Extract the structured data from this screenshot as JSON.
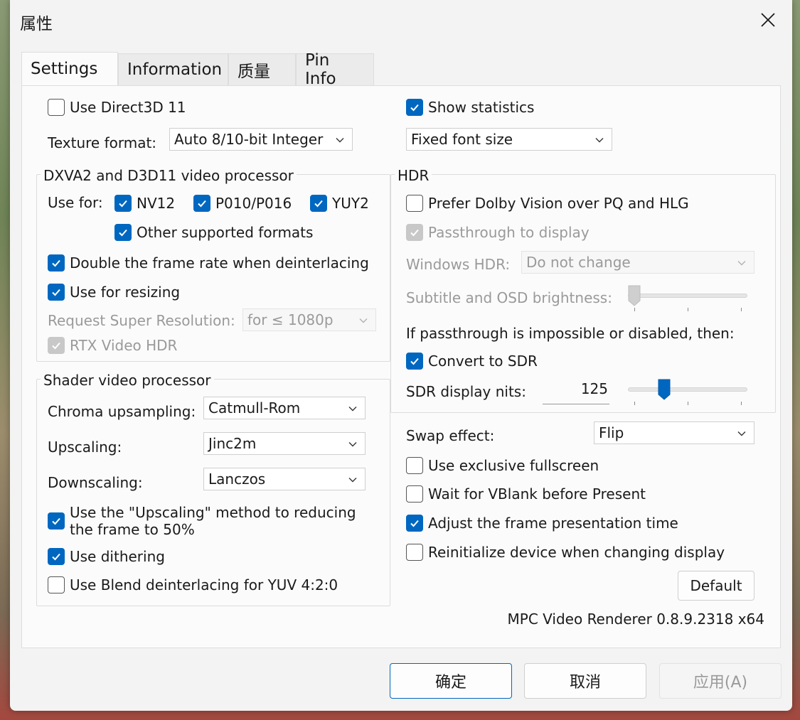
{
  "window": {
    "title": "属性"
  },
  "tabs": [
    {
      "label": "Settings"
    },
    {
      "label": "Information"
    },
    {
      "label": "质量"
    },
    {
      "label": "Pin Info"
    }
  ],
  "settings": {
    "use_d3d11": {
      "label": "Use Direct3D 11",
      "checked": false
    },
    "texture_format": {
      "label": "Texture format:",
      "value": "Auto 8/10-bit Integer"
    },
    "show_statistics": {
      "label": "Show statistics",
      "checked": true
    },
    "stats_font": {
      "value": "Fixed font size"
    },
    "dxva": {
      "title": "DXVA2 and D3D11 video processor",
      "use_for_label": "Use for:",
      "nv12": {
        "label": "NV12",
        "checked": true
      },
      "p010": {
        "label": "P010/P016",
        "checked": true
      },
      "yuy2": {
        "label": "YUY2",
        "checked": true
      },
      "other": {
        "label": "Other supported formats",
        "checked": true
      },
      "double_rate": {
        "label": "Double the frame rate when deinterlacing",
        "checked": true
      },
      "resizing": {
        "label": "Use for resizing",
        "checked": true
      },
      "super_res_label": "Request Super Resolution:",
      "super_res_value": "for ≤ 1080p",
      "rtx_hdr": {
        "label": "RTX Video HDR",
        "checked": true
      }
    },
    "shader": {
      "title": "Shader video processor",
      "chroma_label": "Chroma upsampling:",
      "chroma_value": "Catmull-Rom",
      "upscaling_label": "Upscaling:",
      "upscaling_value": "Jinc2m",
      "downscaling_label": "Downscaling:",
      "downscaling_value": "Lanczos",
      "upscale_method_line1": "Use the \"Upscaling\" method to reducing",
      "upscale_method_line2": "the frame to 50%",
      "dithering": {
        "label": "Use dithering",
        "checked": true
      },
      "blend": {
        "label": "Use Blend deinterlacing for YUV 4:2:0",
        "checked": false
      }
    },
    "hdr": {
      "title": "HDR",
      "dolby": {
        "label": "Prefer Dolby Vision over PQ and HLG",
        "checked": false
      },
      "passthrough": {
        "label": "Passthrough to display",
        "checked": true
      },
      "windows_hdr_label": "Windows HDR:",
      "windows_hdr_value": "Do not change",
      "osd_brightness_label": "Subtitle and OSD brightness:",
      "osd_brightness_level": 0,
      "fallback_label": "If passthrough is impossible or disabled, then:",
      "convert_sdr": {
        "label": "Convert to SDR",
        "checked": true
      },
      "sdr_nits_label": "SDR display nits:",
      "sdr_nits_value": "125",
      "sdr_nits_level": 0.28
    },
    "swap_effect_label": "Swap effect:",
    "swap_effect_value": "Flip",
    "exclusive_fullscreen": {
      "label": "Use exclusive fullscreen",
      "checked": false
    },
    "vblank": {
      "label": "Wait for VBlank before Present",
      "checked": false
    },
    "adjust_presentation": {
      "label": "Adjust the frame presentation time",
      "checked": true
    },
    "reinit_device": {
      "label": "Reinitialize device when changing display",
      "checked": false
    },
    "default_button": "Default",
    "version": "MPC Video Renderer 0.8.9.2318 x64"
  },
  "footer": {
    "ok": "确定",
    "cancel": "取消",
    "apply": "应用(A)"
  },
  "colors": {
    "accent": "#0067c0",
    "disabled": "#9a9a9a"
  }
}
